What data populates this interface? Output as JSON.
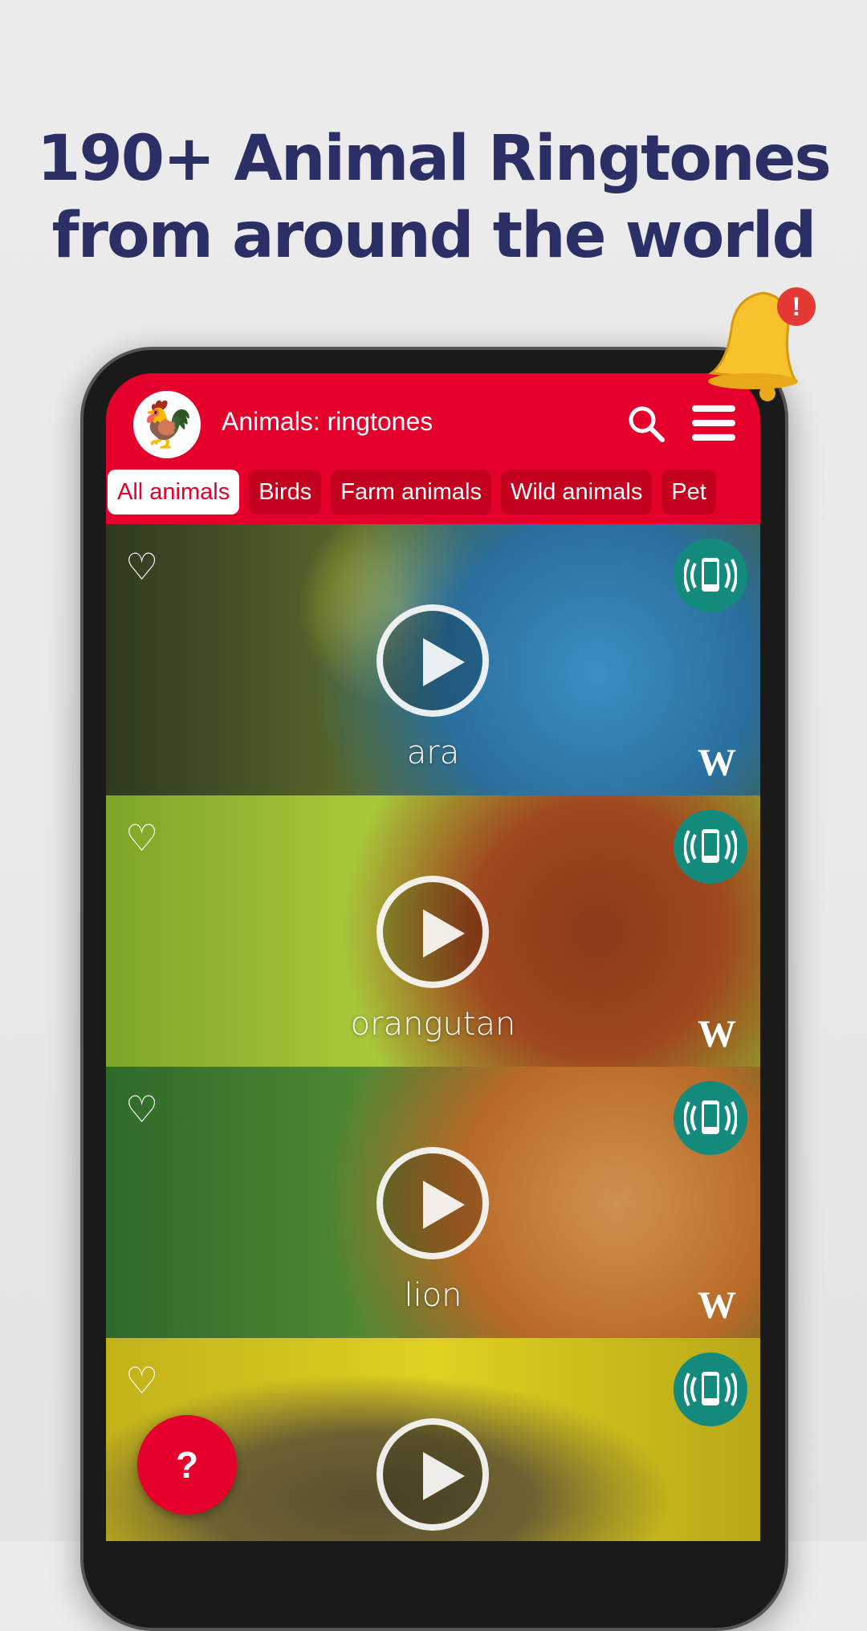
{
  "headline": {
    "line1": "190+ Animal Ringtones",
    "line2": "from around the world"
  },
  "app": {
    "title": "Animals: ringtones",
    "logo_icon": "rooster-icon",
    "accent": "#e4002b"
  },
  "tabs": [
    {
      "label": "All animals",
      "active": true
    },
    {
      "label": "Birds"
    },
    {
      "label": "Farm animals"
    },
    {
      "label": "Wild animals"
    },
    {
      "label": "Pet"
    }
  ],
  "cards": [
    {
      "name": "ara"
    },
    {
      "name": "orangutan"
    },
    {
      "name": "lion"
    },
    {
      "name": ""
    }
  ],
  "wiki_mark": "W",
  "fab": {
    "label": "?"
  },
  "bell_badge": "!"
}
